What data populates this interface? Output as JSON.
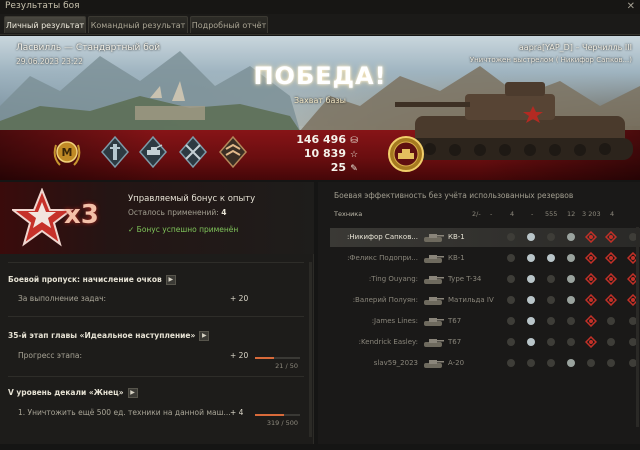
{
  "window": {
    "title": "Результаты боя",
    "close_glyph": "✕"
  },
  "tabs": [
    {
      "label": "Личный результат",
      "active": true
    },
    {
      "label": "Командный результат",
      "active": false
    },
    {
      "label": "Подробный отчёт",
      "active": false
    }
  ],
  "header": {
    "map_mode": "Ласвилль — Стандартный бой",
    "datetime": "29.06.2023 23:22",
    "player": "aapra[YAP_D] – Черчилль III",
    "destroyed_by": "Уничтожен выстрелом ( Никифор Сапков...)",
    "result": "ПОБЕДА!",
    "reason": "Захват базы"
  },
  "rewards": {
    "credits": "146 496",
    "xp": "10 839",
    "free_xp": "25"
  },
  "achievements": [
    "mastery-badge-m",
    "achievement-1",
    "achievement-2",
    "achievement-3",
    "achievement-4",
    "top-medal"
  ],
  "bonus": {
    "multiplier": "x3",
    "title": "Управляемый бонус к опыту",
    "remaining_label": "Осталось применений:",
    "remaining_value": "4",
    "status": "✓ Бонус успешно применён"
  },
  "progress": {
    "battle_pass": {
      "title": "Боевой пропуск: начисление очков",
      "row_label": "За выполнение задач:",
      "row_value": "+ 20"
    },
    "chapter": {
      "title": "35-й этап главы «Идеальное наступление»",
      "row_label": "Прогресс этапа:",
      "row_value": "+ 20",
      "current": "21",
      "total": "50",
      "counter": "21 / 50",
      "fraction": 0.42
    },
    "decal": {
      "title": "V уровень декали «Жнец»",
      "row_label": "1. Уничтожить ещё 500 ед. техники на данной маш...",
      "row_value": "+ 4",
      "counter": "319 / 500",
      "fraction": 0.638
    }
  },
  "table": {
    "caption": "Боевая эффективность без учёта использованных резервов",
    "columns": [
      "Техника",
      "2/-",
      "-",
      "4",
      "-",
      "555",
      "12",
      "3 203",
      "4"
    ],
    "rows": [
      {
        "player": ":Никифор Сапков...",
        "vehicle": "КВ-1",
        "selected": true
      },
      {
        "player": ":Феликс Подопри...",
        "vehicle": "КВ-1",
        "selected": false
      },
      {
        "player": ":Ting Ouyang:",
        "vehicle": "Type T-34",
        "selected": false
      },
      {
        "player": ":Валерий Полуян:",
        "vehicle": "Матильда IV",
        "selected": false
      },
      {
        "player": ":James Lines:",
        "vehicle": "T67",
        "selected": false
      },
      {
        "player": ":Kendrick Easley:",
        "vehicle": "T67",
        "selected": false
      },
      {
        "player": "slav59_2023",
        "vehicle": "A-20",
        "selected": false
      }
    ]
  }
}
